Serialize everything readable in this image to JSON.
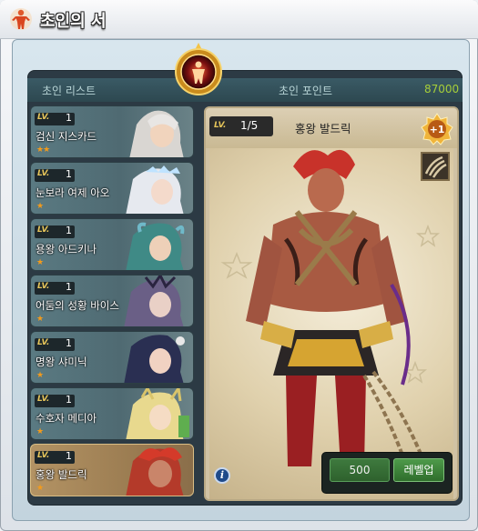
{
  "window": {
    "title": "초인의 서"
  },
  "header": {
    "list_label": "초인 리스트",
    "points_label": "초인 포인트",
    "points_value": "87000"
  },
  "list": {
    "items": [
      {
        "lv_label": "LV.",
        "level": "1",
        "name": "검신 지스카드",
        "stars": "★★",
        "star_count": 2,
        "selected": false
      },
      {
        "lv_label": "LV.",
        "level": "1",
        "name": "눈보라 여제 아오",
        "stars": "★",
        "star_count": 1,
        "selected": false
      },
      {
        "lv_label": "LV.",
        "level": "1",
        "name": "용왕 아드키나",
        "stars": "★",
        "star_count": 1,
        "selected": false
      },
      {
        "lv_label": "LV.",
        "level": "1",
        "name": "어둠의 성황 바이스",
        "stars": "★",
        "star_count": 1,
        "selected": false
      },
      {
        "lv_label": "LV.",
        "level": "1",
        "name": "명왕 샤미닉",
        "stars": "★",
        "star_count": 1,
        "selected": false
      },
      {
        "lv_label": "LV.",
        "level": "1",
        "name": "수호자 메디아",
        "stars": "★",
        "star_count": 1,
        "selected": false
      },
      {
        "lv_label": "LV.",
        "level": "1",
        "name": "홍왕 발드릭",
        "stars": "★",
        "star_count": 1,
        "selected": true
      }
    ]
  },
  "detail": {
    "lv_label": "LV.",
    "level": "1/5",
    "name": "홍왕 발드릭",
    "badge": "+1",
    "info_icon": "i",
    "cost": "500",
    "levelup_label": "레벨업"
  },
  "colors": {
    "points": "#a6ce39",
    "star": "#f49b1a",
    "lv_gold": "#e6c55a"
  }
}
